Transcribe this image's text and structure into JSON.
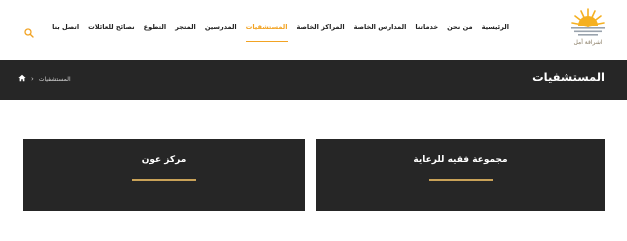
{
  "brand": {
    "logo_text": "اشراقة أمل",
    "accent_color": "#f2a323",
    "logo_colors": [
      "#f5b021",
      "#9aa3ad"
    ]
  },
  "nav": {
    "items": [
      {
        "label": "الرئيسية",
        "active": false
      },
      {
        "label": "من نحن",
        "active": false
      },
      {
        "label": "خدماتنا",
        "active": false
      },
      {
        "label": "المدارس الخاصة",
        "active": false
      },
      {
        "label": "المراكز الخاصة",
        "active": false
      },
      {
        "label": "المستشفيات",
        "active": true
      },
      {
        "label": "المدرسين",
        "active": false
      },
      {
        "label": "المتجر",
        "active": false
      },
      {
        "label": "التطوع",
        "active": false
      },
      {
        "label": "نصائح للعائلات",
        "active": false
      },
      {
        "label": "اتصل بنا",
        "active": false
      }
    ],
    "search_icon": "search-icon"
  },
  "title_bar": {
    "title": "المستشفيات",
    "breadcrumb": {
      "home_icon": "home-icon",
      "current": "المستشفيات"
    }
  },
  "cards": [
    {
      "title": "مجموعة فقيه للرعاية"
    },
    {
      "title": "مركز عون"
    }
  ]
}
